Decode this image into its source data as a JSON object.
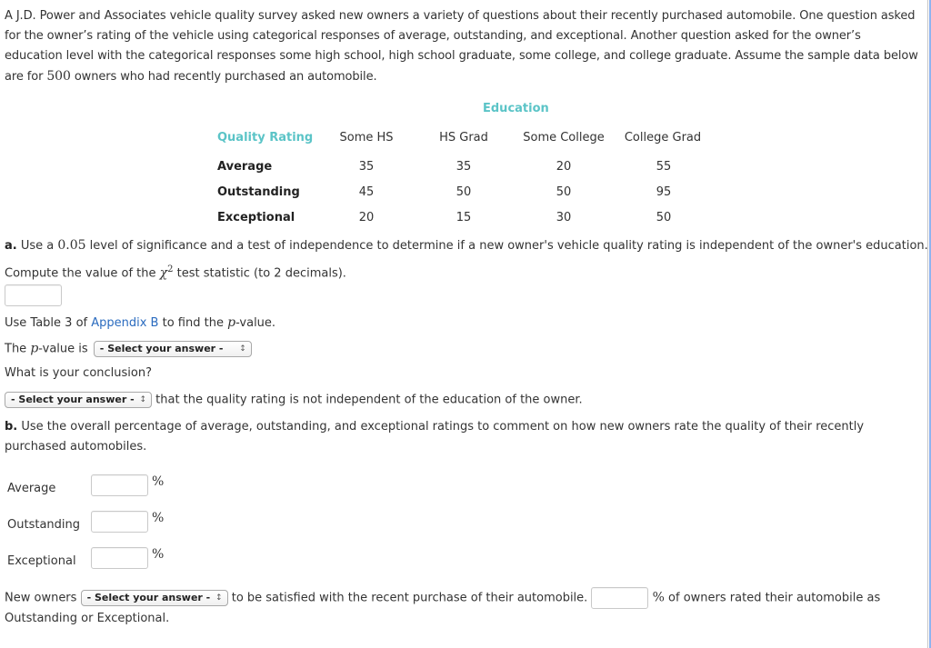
{
  "intro": {
    "text_1": "A J.D. Power and Associates vehicle quality survey asked new owners a variety of questions about their recently purchased automobile. One question asked for the owner’s rating of the vehicle using categorical responses of average, outstanding, and exceptional. Another question asked for the owner’s education level with the categorical responses some high school, high school graduate, some college, and college graduate. Assume the sample data below are for ",
    "sample_size": "500",
    "text_2": " owners who had recently purchased an automobile."
  },
  "table": {
    "column_group_header": "Education",
    "row_group_header": "Quality Rating",
    "columns": [
      "Some HS",
      "HS Grad",
      "Some College",
      "College Grad"
    ],
    "rows": [
      {
        "label": "Average",
        "values": [
          "35",
          "35",
          "20",
          "55"
        ]
      },
      {
        "label": "Outstanding",
        "values": [
          "45",
          "50",
          "50",
          "95"
        ]
      },
      {
        "label": "Exceptional",
        "values": [
          "20",
          "15",
          "30",
          "50"
        ]
      }
    ],
    "header_color": "#5bc4c7"
  },
  "part_a": {
    "label": "a.",
    "text_1": " Use a ",
    "alpha": "0.05",
    "text_2": " level of significance and a test of independence to determine if a new owner's vehicle quality rating is independent of the owner's education.",
    "compute_text_1": "Compute the value of the ",
    "chi_symbol": "χ",
    "chi_exp": "2",
    "compute_text_2": " test statistic (to 2 decimals).",
    "chi_square_input": {
      "value": "",
      "placeholder": ""
    },
    "table_text_1": "Use Table 3 of ",
    "table_link": "Appendix B",
    "table_text_2": " to find the ",
    "p_symbol": "p",
    "table_text_3": "-value.",
    "pvalue_text_1": "The ",
    "pvalue_text_2": "-value is",
    "pvalue_select": "- Select your answer -",
    "conclusion_question": "What is your conclusion?",
    "conclusion_select": "- Select your answer -",
    "conclusion_text": "that the quality rating is not independent of the education of the owner."
  },
  "part_b": {
    "label": "b.",
    "text": " Use the overall percentage of average, outstanding, and exceptional ratings to comment on how new owners rate the quality of their recently purchased automobiles.",
    "rows": [
      {
        "label": "Average",
        "value": "",
        "unit": "%"
      },
      {
        "label": "Outstanding",
        "value": "",
        "unit": "%"
      },
      {
        "label": "Exceptional",
        "value": "",
        "unit": "%"
      }
    ],
    "final_text_1": "New owners",
    "final_select": "- Select your answer -",
    "final_text_2": "to be satisfied with the recent purchase of their automobile.",
    "final_input": {
      "value": "",
      "placeholder": ""
    },
    "final_unit": "%",
    "final_text_3": "of owners rated their automobile as",
    "final_text_4": "Outstanding or Exceptional."
  },
  "select_arrow_glyph": "↕",
  "colors": {
    "accent_teal": "#5bc4c7",
    "link_blue": "#2a6bbf",
    "text": "#333333"
  }
}
